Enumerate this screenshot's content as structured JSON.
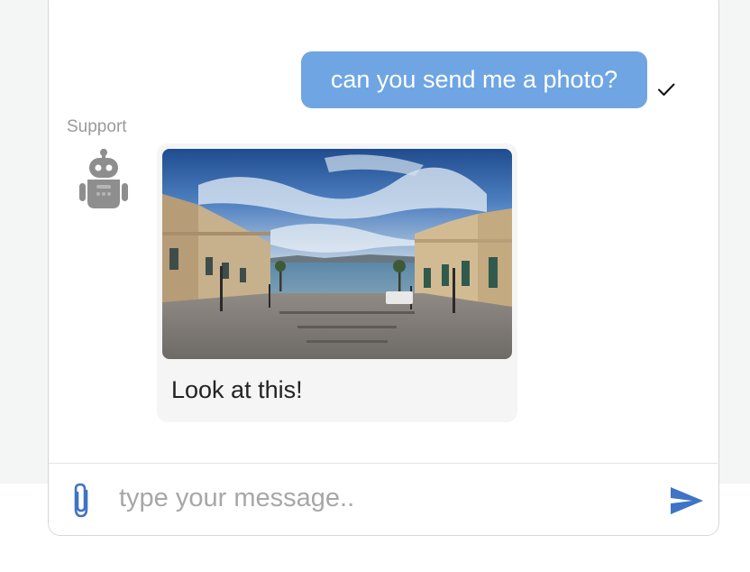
{
  "messages": {
    "outgoing": {
      "text": "can you send me a photo?",
      "status_icon": "check-icon"
    },
    "incoming": {
      "sender": "Support",
      "avatar_icon": "robot-icon",
      "image_alt": "photo",
      "text": "Look at this!"
    }
  },
  "composer": {
    "placeholder": "type your message..",
    "attach_icon": "paperclip-icon",
    "send_icon": "send-icon"
  },
  "colors": {
    "user_bubble": "#6fa5e3",
    "bot_bubble": "#f5f5f5",
    "send_accent": "#3f73c6",
    "page_background": "#f4f5f5"
  }
}
